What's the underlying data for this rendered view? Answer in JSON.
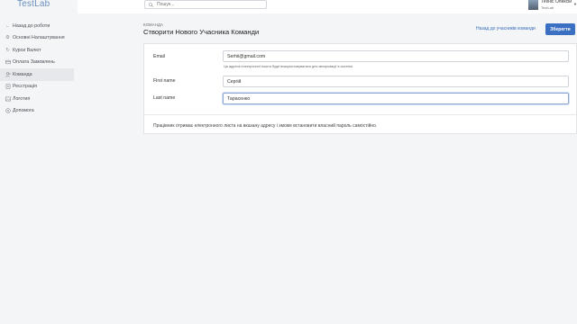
{
  "app": {
    "logo": "TestLab"
  },
  "sidebar": {
    "items": [
      {
        "label": "Назад до роботи",
        "icon": "arrow-left-icon"
      },
      {
        "label": "Основні Налаштування",
        "icon": "gear-icon"
      },
      {
        "label": "Курси Валют",
        "icon": "refresh-icon"
      },
      {
        "label": "Оплата Замовлень",
        "icon": "card-icon"
      },
      {
        "label": "Команда",
        "icon": "users-icon",
        "active": true
      },
      {
        "label": "Реєстрація",
        "icon": "checklist-icon"
      },
      {
        "label": "Логотип",
        "icon": "image-icon"
      },
      {
        "label": "Допомога",
        "icon": "help-icon"
      }
    ]
  },
  "topbar": {
    "search_placeholder": "Пошук...",
    "user_name": "Техніс Олексій",
    "user_company": "TestLab"
  },
  "header": {
    "breadcrumb": "КОМАНДА",
    "title": "Створити Нового Учасника Команди",
    "back_link": "Назад до учасників команди",
    "save_label": "Зберегти"
  },
  "form": {
    "email_label": "Email",
    "email_value": "Serhii@gmail.com",
    "email_hint": "Ця адреса електронної пошти буде використовуватися для авторизації в системі.",
    "first_name_label": "First name",
    "first_name_value": "Сергій",
    "last_name_label": "Last name",
    "last_name_value": "Тарасенко",
    "note": "Працівник отримає електронного листа на вказану адресу і зможе встановити власний пароль самостійно."
  },
  "colors": {
    "accent": "#3b6fc1",
    "link": "#3a6fb6",
    "logo": "#6b8fbf"
  }
}
